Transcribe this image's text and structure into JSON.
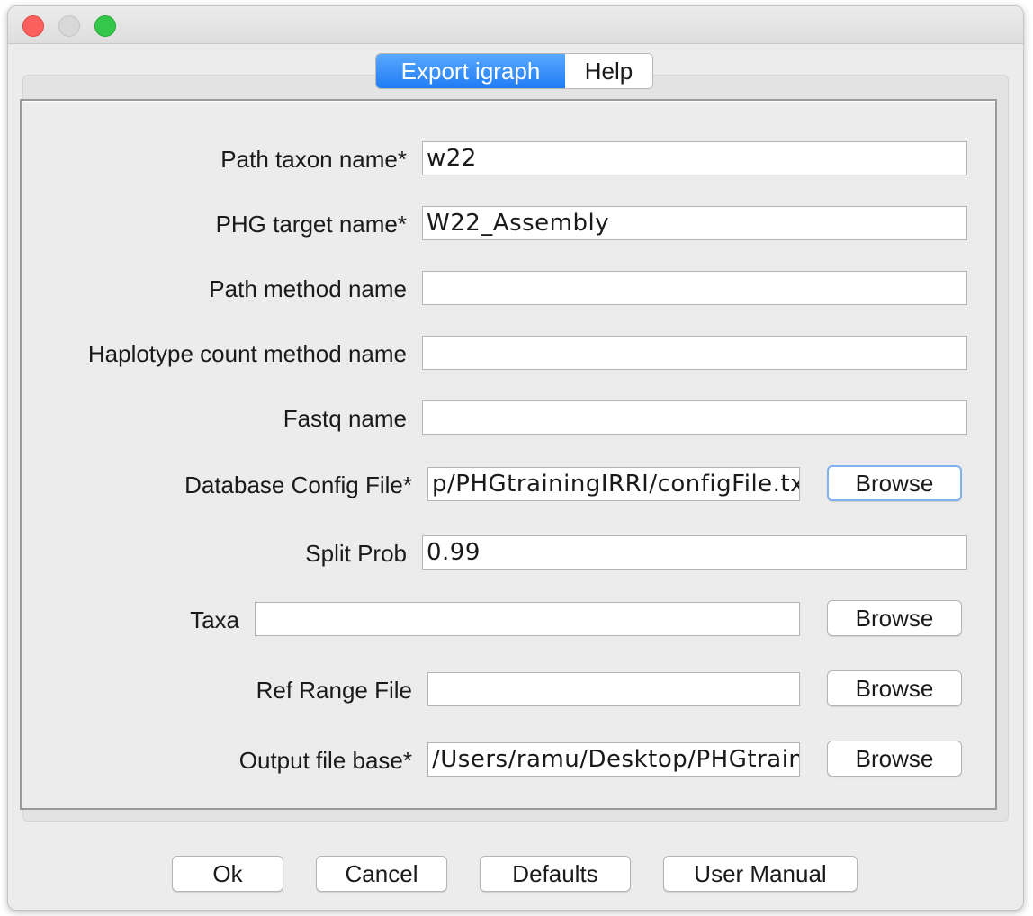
{
  "window": {
    "tabs": [
      {
        "label": "Export igraph"
      },
      {
        "label": "Help"
      }
    ]
  },
  "form": {
    "path_taxon_name": {
      "label": "Path taxon name*",
      "value": "w22"
    },
    "phg_target_name": {
      "label": "PHG target name*",
      "value": "W22_Assembly"
    },
    "path_method_name": {
      "label": "Path method name",
      "value": ""
    },
    "haplotype_count_method_name": {
      "label": "Haplotype count method name",
      "value": ""
    },
    "fastq_name": {
      "label": "Fastq name",
      "value": ""
    },
    "database_config_file": {
      "label": "Database Config File*",
      "value": "p/PHGtrainingIRRI/configFile.txt",
      "browse": "Browse"
    },
    "split_prob": {
      "label": "Split Prob",
      "value": "0.99"
    },
    "taxa": {
      "label": "Taxa",
      "value": "",
      "browse": "Browse"
    },
    "ref_range_file": {
      "label": "Ref Range File",
      "value": "",
      "browse": "Browse"
    },
    "output_file_base": {
      "label": "Output file base*",
      "value": "/Users/ramu/Desktop/PHGtrain",
      "browse": "Browse"
    }
  },
  "buttons": {
    "ok": "Ok",
    "cancel": "Cancel",
    "defaults": "Defaults",
    "user_manual": "User Manual"
  }
}
